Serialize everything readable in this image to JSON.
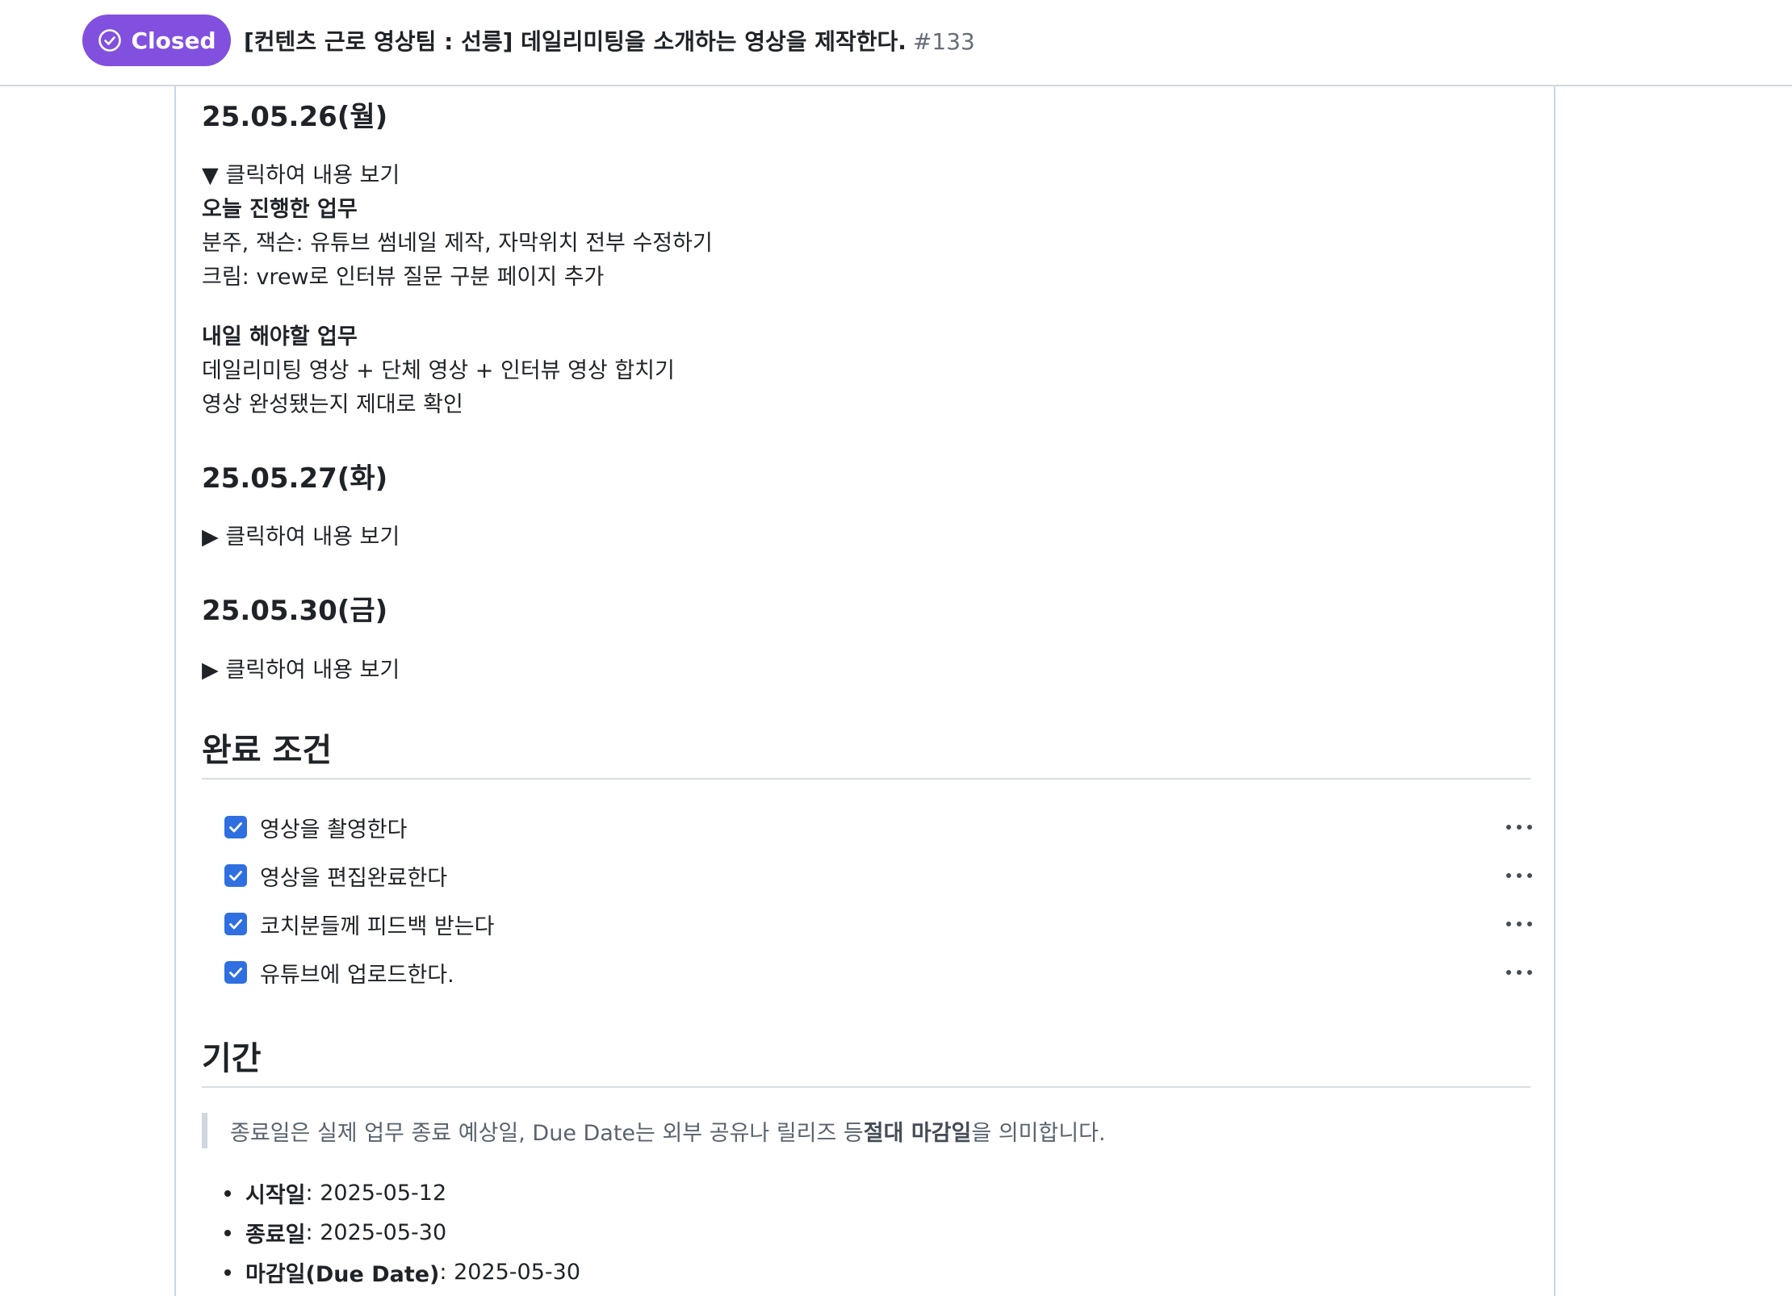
{
  "header": {
    "state": "Closed",
    "title": "[컨텐츠 근로 영상팀 : 선릉] 데일리미팅을 소개하는 영상을 제작한다.",
    "number": "#133"
  },
  "logs": [
    {
      "date": "25.05.26(월)",
      "toggle": "▼ 클릭하여 내용 보기",
      "expanded": true,
      "today_title": "오늘 진행한 업무",
      "today_lines": [
        "분주, 잭슨: 유튜브 썸네일 제작, 자막위치 전부 수정하기",
        "크림: vrew로 인터뷰 질문 구분 페이지 추가"
      ],
      "tomorrow_title": "내일 해야할 업무",
      "tomorrow_lines": [
        "데일리미팅 영상 + 단체 영상 + 인터뷰 영상 합치기",
        "영상 완성됐는지 제대로 확인"
      ]
    },
    {
      "date": "25.05.27(화)",
      "toggle": "▶ 클릭하여 내용 보기",
      "expanded": false
    },
    {
      "date": "25.05.30(금)",
      "toggle": "▶ 클릭하여 내용 보기",
      "expanded": false
    }
  ],
  "completion": {
    "heading": "완료 조건",
    "tasks": [
      {
        "label": "영상을 촬영한다",
        "checked": true
      },
      {
        "label": "영상을 편집완료한다",
        "checked": true
      },
      {
        "label": "코치분들께 피드백 받는다",
        "checked": true
      },
      {
        "label": "유튜브에 업로드한다.",
        "checked": true
      }
    ]
  },
  "period": {
    "heading": "기간",
    "note_before": "종료일은 실제 업무 종료 예상일, Due Date는 외부 공유나 릴리즈 등 ",
    "note_bold": "절대 마감일",
    "note_after": "을 의미합니다.",
    "items": [
      {
        "label": "시작일",
        "value": ": 2025-05-12"
      },
      {
        "label": "종료일",
        "value": ": 2025-05-30"
      },
      {
        "label": "마감일(Due Date)",
        "value": ": 2025-05-30"
      }
    ]
  },
  "colors": {
    "closed_badge": "#8250df",
    "checkbox": "#2f6fe0"
  }
}
